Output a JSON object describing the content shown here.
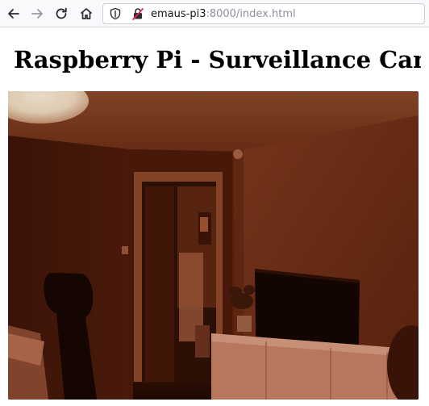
{
  "browser": {
    "nav": {
      "back_icon": "arrow-left-icon",
      "forward_icon": "arrow-right-icon",
      "reload_icon": "reload-icon",
      "home_icon": "home-icon"
    },
    "address_bar": {
      "host": "emaus-pi3",
      "rest": ":8000/index.html",
      "tracking_icon": "shield-icon",
      "security_icon": "insecure-connection-icon"
    }
  },
  "page": {
    "title": "Raspberry Pi - Surveillance Camera Stream",
    "feed": {
      "description_icon": "camera-stream-image"
    }
  },
  "colors": {
    "toolbar_bg": "#f9f9fb",
    "feed_tint": "#7a3418",
    "feed_dark": "#1e0904"
  }
}
